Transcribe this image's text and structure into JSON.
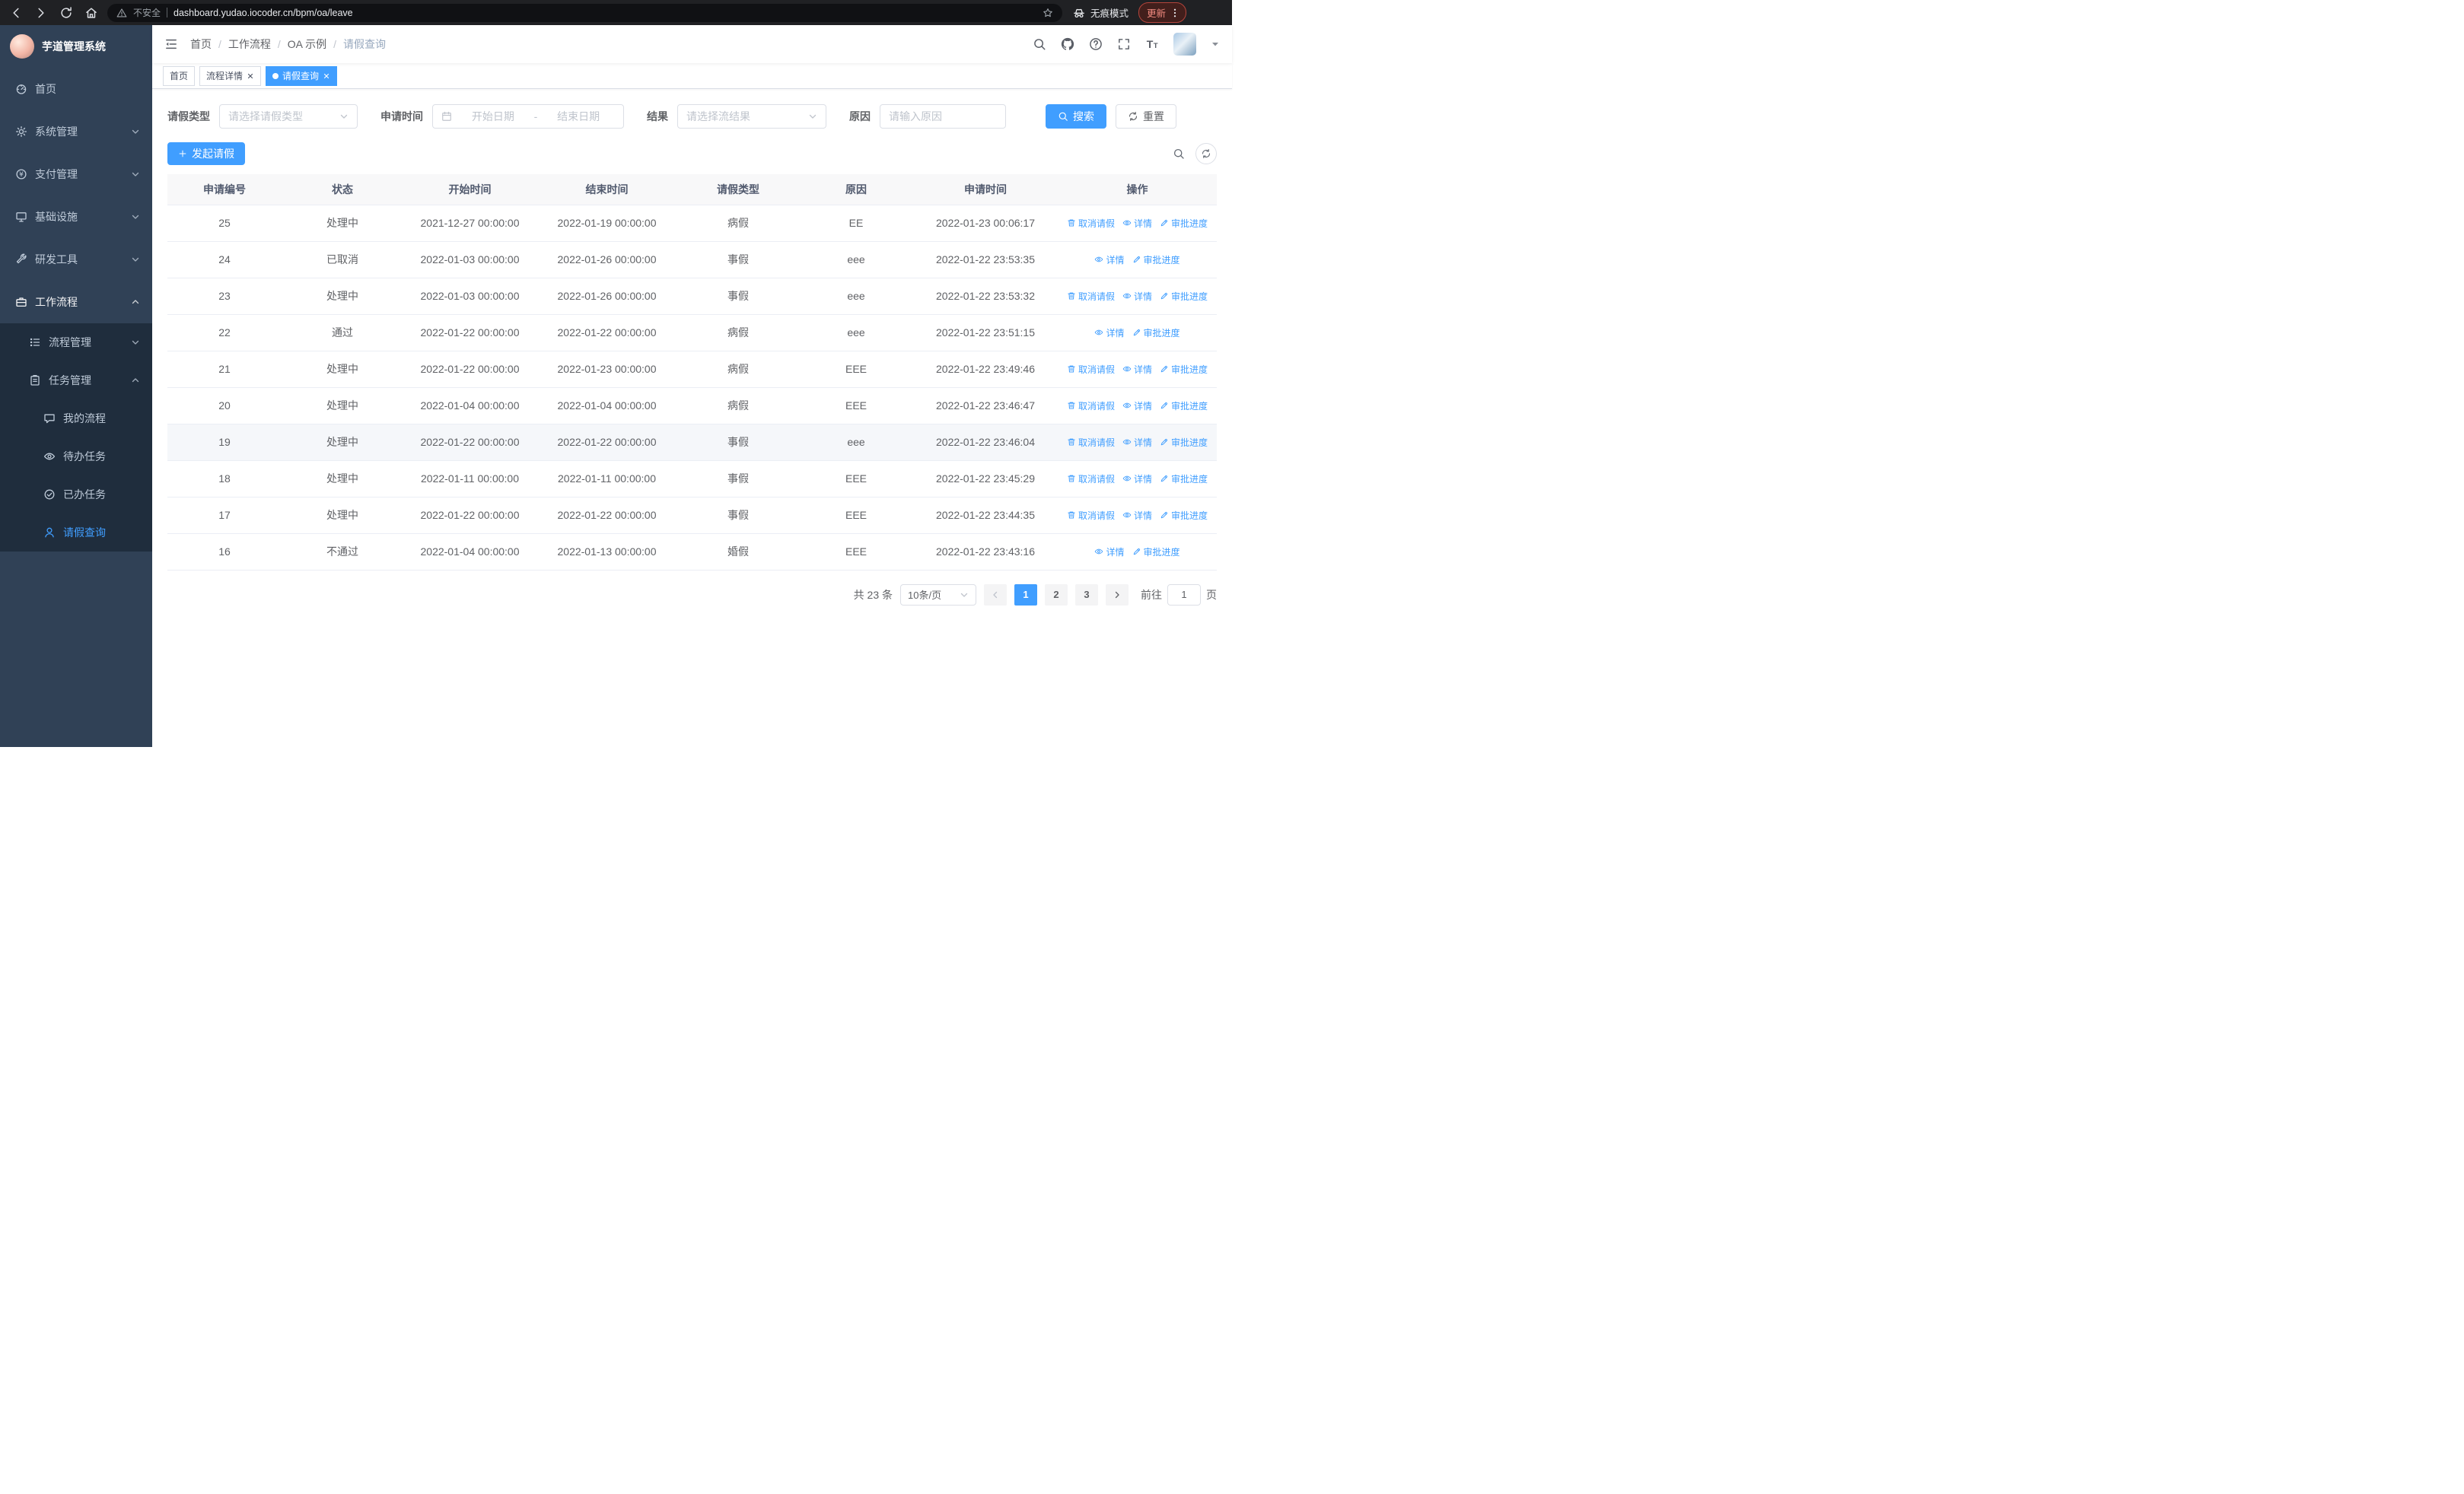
{
  "browser": {
    "security_label": "不安全",
    "url": "dashboard.yudao.iocoder.cn/bpm/oa/leave",
    "incognito_label": "无痕模式",
    "update_label": "更新"
  },
  "sidebar": {
    "logo_title": "芋道管理系统",
    "items": [
      {
        "label": "首页"
      },
      {
        "label": "系统管理"
      },
      {
        "label": "支付管理"
      },
      {
        "label": "基础设施"
      },
      {
        "label": "研发工具"
      },
      {
        "label": "工作流程"
      }
    ],
    "submenu_items": [
      {
        "label": "流程管理"
      },
      {
        "label": "任务管理"
      }
    ],
    "task_children": [
      {
        "label": "我的流程"
      },
      {
        "label": "待办任务"
      },
      {
        "label": "已办任务"
      },
      {
        "label": "请假查询"
      }
    ]
  },
  "breadcrumb": {
    "items": [
      "首页",
      "工作流程",
      "OA 示例",
      "请假查询"
    ],
    "separator": "/"
  },
  "tabs": [
    {
      "label": "首页"
    },
    {
      "label": "流程详情"
    },
    {
      "label": "请假查询"
    }
  ],
  "filters": {
    "leave_type": {
      "label": "请假类型",
      "placeholder": "请选择请假类型"
    },
    "apply_time": {
      "label": "申请时间",
      "start_placeholder": "开始日期",
      "separator": "-",
      "end_placeholder": "结束日期"
    },
    "result": {
      "label": "结果",
      "placeholder": "请选择流结果"
    },
    "reason": {
      "label": "原因",
      "placeholder": "请输入原因"
    },
    "search_label": "搜索",
    "reset_label": "重置"
  },
  "toolbar": {
    "create_label": "发起请假"
  },
  "table": {
    "columns": [
      "申请编号",
      "状态",
      "开始时间",
      "结束时间",
      "请假类型",
      "原因",
      "申请时间",
      "操作"
    ],
    "actions": {
      "cancel": "取消请假",
      "detail": "详情",
      "progress": "审批进度"
    },
    "rows": [
      {
        "id": "25",
        "status": "处理中",
        "start_time": "2021-12-27 00:00:00",
        "end_time": "2022-01-19 00:00:00",
        "leave_type": "病假",
        "reason": "EE",
        "apply_time": "2022-01-23 00:06:17",
        "cancellable": true,
        "highlighted": false
      },
      {
        "id": "24",
        "status": "已取消",
        "start_time": "2022-01-03 00:00:00",
        "end_time": "2022-01-26 00:00:00",
        "leave_type": "事假",
        "reason": "eee",
        "apply_time": "2022-01-22 23:53:35",
        "cancellable": false,
        "highlighted": false
      },
      {
        "id": "23",
        "status": "处理中",
        "start_time": "2022-01-03 00:00:00",
        "end_time": "2022-01-26 00:00:00",
        "leave_type": "事假",
        "reason": "eee",
        "apply_time": "2022-01-22 23:53:32",
        "cancellable": true,
        "highlighted": false
      },
      {
        "id": "22",
        "status": "通过",
        "start_time": "2022-01-22 00:00:00",
        "end_time": "2022-01-22 00:00:00",
        "leave_type": "病假",
        "reason": "eee",
        "apply_time": "2022-01-22 23:51:15",
        "cancellable": false,
        "highlighted": false
      },
      {
        "id": "21",
        "status": "处理中",
        "start_time": "2022-01-22 00:00:00",
        "end_time": "2022-01-23 00:00:00",
        "leave_type": "病假",
        "reason": "EEE",
        "apply_time": "2022-01-22 23:49:46",
        "cancellable": true,
        "highlighted": false
      },
      {
        "id": "20",
        "status": "处理中",
        "start_time": "2022-01-04 00:00:00",
        "end_time": "2022-01-04 00:00:00",
        "leave_type": "病假",
        "reason": "EEE",
        "apply_time": "2022-01-22 23:46:47",
        "cancellable": true,
        "highlighted": false
      },
      {
        "id": "19",
        "status": "处理中",
        "start_time": "2022-01-22 00:00:00",
        "end_time": "2022-01-22 00:00:00",
        "leave_type": "事假",
        "reason": "eee",
        "apply_time": "2022-01-22 23:46:04",
        "cancellable": true,
        "highlighted": true
      },
      {
        "id": "18",
        "status": "处理中",
        "start_time": "2022-01-11 00:00:00",
        "end_time": "2022-01-11 00:00:00",
        "leave_type": "事假",
        "reason": "EEE",
        "apply_time": "2022-01-22 23:45:29",
        "cancellable": true,
        "highlighted": false
      },
      {
        "id": "17",
        "status": "处理中",
        "start_time": "2022-01-22 00:00:00",
        "end_time": "2022-01-22 00:00:00",
        "leave_type": "事假",
        "reason": "EEE",
        "apply_time": "2022-01-22 23:44:35",
        "cancellable": true,
        "highlighted": false
      },
      {
        "id": "16",
        "status": "不通过",
        "start_time": "2022-01-04 00:00:00",
        "end_time": "2022-01-13 00:00:00",
        "leave_type": "婚假",
        "reason": "EEE",
        "apply_time": "2022-01-22 23:43:16",
        "cancellable": false,
        "highlighted": false
      }
    ]
  },
  "pagination": {
    "total_label": "共 23 条",
    "page_size_label": "10条/页",
    "pages": [
      "1",
      "2",
      "3"
    ],
    "active_page": "1",
    "goto_label": "前往",
    "goto_value": "1",
    "goto_suffix": "页"
  },
  "colors": {
    "accent": "#409eff",
    "sidebar_bg": "#304156",
    "submenu_bg": "#1f2d3d"
  }
}
